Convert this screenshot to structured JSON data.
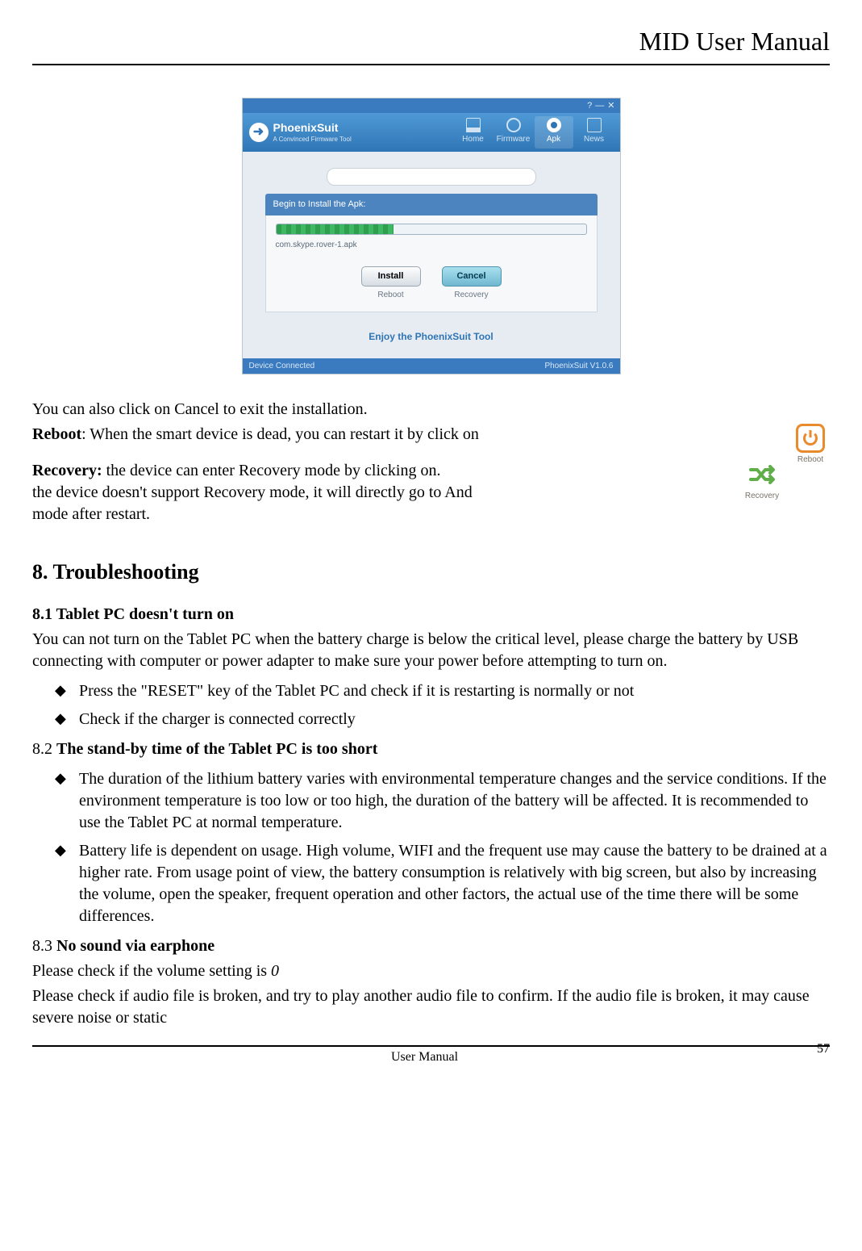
{
  "header": {
    "title": "MID User Manual"
  },
  "app": {
    "brand": {
      "name": "PhoenixSuit",
      "sub": "A Convinced Firmware Tool"
    },
    "nav": [
      {
        "label": "Home"
      },
      {
        "label": "Firmware"
      },
      {
        "label": "Apk"
      },
      {
        "label": "News"
      }
    ],
    "install_label": "Begin to Install the Apk:",
    "apk_name": "com.skype.rover-1.apk",
    "buttons": {
      "install": "Install",
      "cancel": "Cancel",
      "reboot_sub": "Reboot",
      "recovery_sub": "Recovery"
    },
    "tagline": "Enjoy the PhoenixSuit Tool",
    "status_left": "Device Connected",
    "status_right": "PhoenixSuit V1.0.6"
  },
  "body": {
    "p1": "You can also click on Cancel to exit the installation.",
    "reboot_label": "Reboot",
    "reboot_text": ": When the smart device is dead, you can restart it by click on",
    "recovery_label": "Recovery:",
    "recovery_line1": " the device can enter Recovery mode by clicking on.",
    "recovery_line2": "the device doesn't support Recovery mode, it will directly go to And",
    "recovery_line3": "mode after restart.",
    "reboot_icon_label": "Reboot",
    "recovery_icon_label": "Recovery"
  },
  "h8": "8. Troubleshooting",
  "s81": {
    "title": "8.1 Tablet PC doesn't turn on",
    "p": "You can not turn on the Tablet PC when the battery charge is below the critical level, please charge the battery by USB connecting with computer or power adapter to make sure your power before attempting to turn on.",
    "b1": "Press the \"RESET\" key of the Tablet PC and check if it is restarting is normally or not",
    "b2": "Check if the charger is connected correctly"
  },
  "s82": {
    "prefix": "8.2 ",
    "title": "The stand-by time of the Tablet PC is too short",
    "b1": "The duration of the lithium battery varies with environmental temperature changes and the service conditions. If the environment temperature is too low or too high,    the duration of the battery will be affected. It is recommended to use the Tablet PC at normal temperature.",
    "b2": "Battery life is dependent on usage. High volume, WIFI and the frequent use may cause the battery to be drained at a higher rate. From usage point of view, the battery consumption is relatively with big screen, but also by increasing the volume, open the speaker, frequent operation and other factors, the actual use of the time there will be some differences."
  },
  "s83": {
    "prefix": "8.3 ",
    "title": "No sound via earphone",
    "p1a": "Please check if the volume setting is ",
    "p1b": "0",
    "p2": "Please check if audio file is broken, and try to play another audio file to confirm. If the audio file is broken, it may cause severe noise or static"
  },
  "footer": {
    "center": "User Manual",
    "page": "57"
  }
}
